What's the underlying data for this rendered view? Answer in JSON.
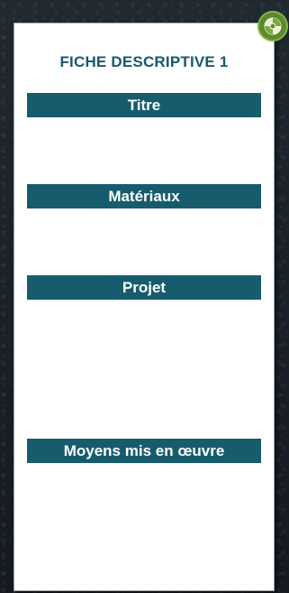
{
  "sheet": {
    "title": "FICHE DESCRIPTIVE 1",
    "sections": [
      {
        "label": "Titre"
      },
      {
        "label": "Matériaux"
      },
      {
        "label": "Projet"
      },
      {
        "label": "Moyens mis en œuvre"
      }
    ]
  },
  "badge": {
    "icon": "disc-icon",
    "color": "#5a8a2a"
  },
  "colors": {
    "accent": "#175c6d",
    "title": "#175a6b"
  }
}
